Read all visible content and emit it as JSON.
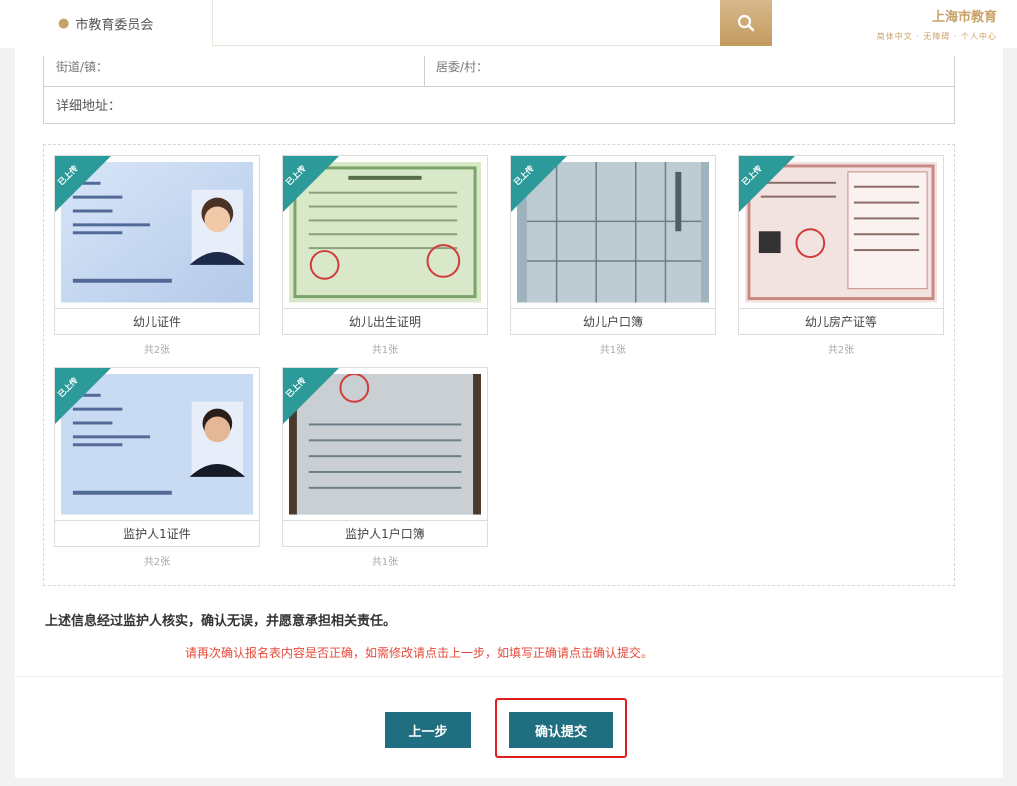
{
  "header": {
    "location": "市教育委员会",
    "search_placeholder": "",
    "brand_title": "上海市教育",
    "brand_sub": "简体中文 · 无障碍 · 个人中心"
  },
  "address": {
    "field1": "街道/镇：",
    "field2": "居委/村：",
    "detail_label": "详细地址："
  },
  "docs": [
    {
      "ribbon": "已上传",
      "caption": "幼儿证件",
      "count": "共2张"
    },
    {
      "ribbon": "已上传",
      "caption": "幼儿出生证明",
      "count": "共1张"
    },
    {
      "ribbon": "已上传",
      "caption": "幼儿户口簿",
      "count": "共1张"
    },
    {
      "ribbon": "已上传",
      "caption": "幼儿房产证等",
      "count": "共2张"
    },
    {
      "ribbon": "已上传",
      "caption": "监护人1证件",
      "count": "共2张"
    },
    {
      "ribbon": "已上传",
      "caption": "监护人1户口簿",
      "count": "共1张"
    }
  ],
  "confirm_statement": "上述信息经过监护人核实，确认无误，并愿意承担相关责任。",
  "warning": "请再次确认报名表内容是否正确，如需修改请点击上一步，如填写正确请点击确认提交。",
  "buttons": {
    "prev": "上一步",
    "submit": "确认提交"
  },
  "colors": {
    "accent": "#c8a167",
    "button": "#1f6f80",
    "ribbon": "#2d9a9a",
    "warning": "#e64a3b",
    "highlight": "#e11d1d"
  }
}
